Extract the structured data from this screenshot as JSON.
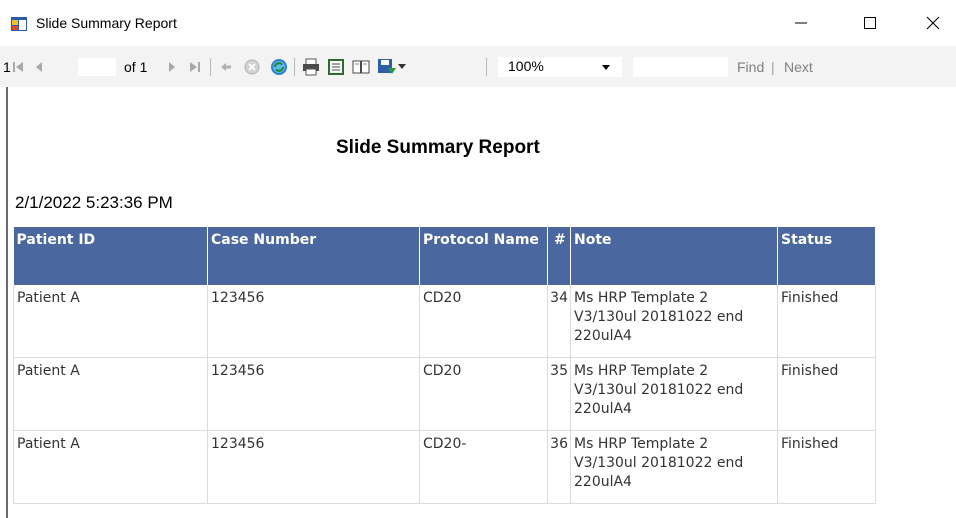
{
  "window": {
    "title": "Slide Summary Report",
    "icons": {
      "app": "report-viewer-icon",
      "minimize": "minimize-icon",
      "maximize": "maximize-icon",
      "close": "close-icon"
    }
  },
  "toolbar": {
    "current_page": "1",
    "of_label": "of 1",
    "zoom": "100%",
    "find_value": "",
    "find_label": "Find",
    "separator": "|",
    "next_label": "Next"
  },
  "report": {
    "title": "Slide Summary Report",
    "timestamp": "2/1/2022 5:23:36 PM",
    "columns": [
      "Patient ID",
      "Case Number",
      "Protocol Name",
      "#",
      "Note",
      "Status"
    ],
    "rows": [
      {
        "patient_id": "Patient A",
        "case_number": "123456",
        "protocol": "CD20",
        "num": "34",
        "note_lines": [
          "Ms HRP Template 2",
          "V3/130ul 20181022 end",
          "220ulA4"
        ],
        "status": "Finished"
      },
      {
        "patient_id": "Patient A",
        "case_number": "123456",
        "protocol": "CD20",
        "num": "35",
        "note_lines": [
          "Ms HRP Template 2",
          "V3/130ul 20181022 end",
          "220ulA4"
        ],
        "status": "Finished"
      },
      {
        "patient_id": "Patient A",
        "case_number": "123456",
        "protocol": "CD20-",
        "num": "36",
        "note_lines": [
          "Ms HRP Template 2",
          "V3/130ul 20181022 end",
          "220ulA4"
        ],
        "status": "Finished"
      }
    ]
  },
  "colors": {
    "header_bg": "#4a67a0",
    "header_text": "#ffffff",
    "toolbar_bg": "#f3f3f3"
  }
}
